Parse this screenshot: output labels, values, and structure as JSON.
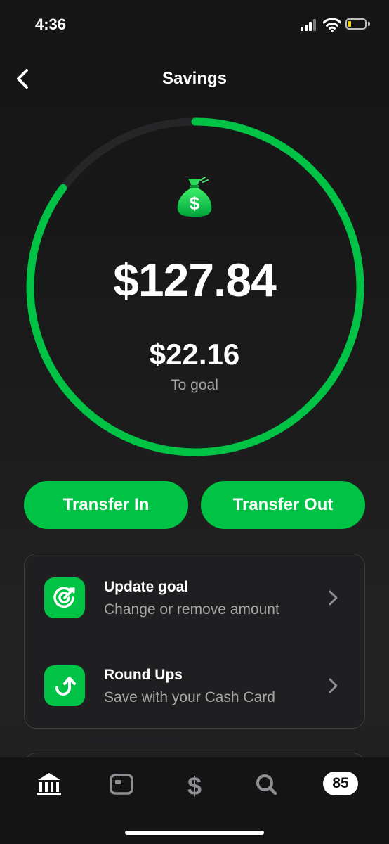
{
  "status_bar": {
    "time": "4:36"
  },
  "header": {
    "title": "Savings",
    "back_icon": "chevron-left-icon"
  },
  "savings": {
    "balance": "$127.84",
    "remaining": "$22.16",
    "remaining_label": "To goal",
    "goal_progress": 0.852,
    "bag_icon": "money-bag-icon",
    "accent_color": "#00c244"
  },
  "actions": {
    "transfer_in": "Transfer In",
    "transfer_out": "Transfer Out"
  },
  "options": [
    {
      "title": "Update goal",
      "subtitle": "Change or remove amount",
      "icon": "target-icon"
    },
    {
      "title": "Round Ups",
      "subtitle": "Save with your Cash Card",
      "icon": "round-up-arrow-icon"
    }
  ],
  "tab_bar": {
    "tabs": [
      "bank-icon",
      "card-icon",
      "dollar-icon",
      "search-icon"
    ],
    "activity_badge": "85"
  }
}
